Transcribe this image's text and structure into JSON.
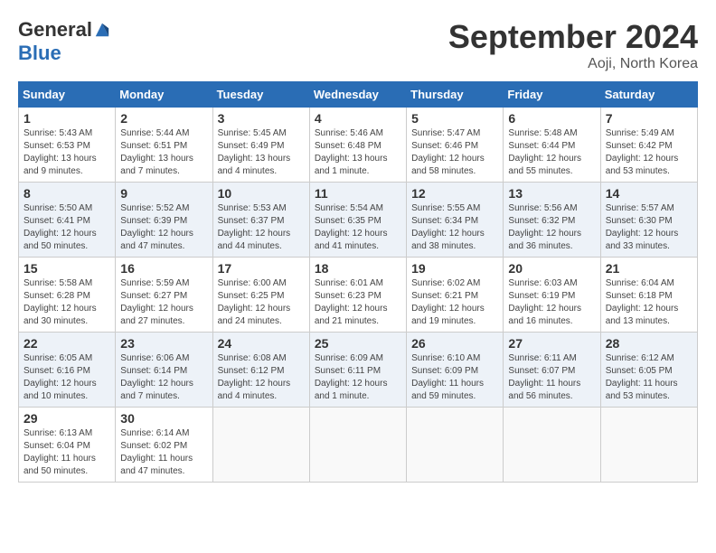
{
  "header": {
    "logo_general": "General",
    "logo_blue": "Blue",
    "month_title": "September 2024",
    "location": "Aoji, North Korea"
  },
  "days_of_week": [
    "Sunday",
    "Monday",
    "Tuesday",
    "Wednesday",
    "Thursday",
    "Friday",
    "Saturday"
  ],
  "weeks": [
    [
      {
        "day": "1",
        "info": "Sunrise: 5:43 AM\nSunset: 6:53 PM\nDaylight: 13 hours and 9 minutes."
      },
      {
        "day": "2",
        "info": "Sunrise: 5:44 AM\nSunset: 6:51 PM\nDaylight: 13 hours and 7 minutes."
      },
      {
        "day": "3",
        "info": "Sunrise: 5:45 AM\nSunset: 6:49 PM\nDaylight: 13 hours and 4 minutes."
      },
      {
        "day": "4",
        "info": "Sunrise: 5:46 AM\nSunset: 6:48 PM\nDaylight: 13 hours and 1 minute."
      },
      {
        "day": "5",
        "info": "Sunrise: 5:47 AM\nSunset: 6:46 PM\nDaylight: 12 hours and 58 minutes."
      },
      {
        "day": "6",
        "info": "Sunrise: 5:48 AM\nSunset: 6:44 PM\nDaylight: 12 hours and 55 minutes."
      },
      {
        "day": "7",
        "info": "Sunrise: 5:49 AM\nSunset: 6:42 PM\nDaylight: 12 hours and 53 minutes."
      }
    ],
    [
      {
        "day": "8",
        "info": "Sunrise: 5:50 AM\nSunset: 6:41 PM\nDaylight: 12 hours and 50 minutes."
      },
      {
        "day": "9",
        "info": "Sunrise: 5:52 AM\nSunset: 6:39 PM\nDaylight: 12 hours and 47 minutes."
      },
      {
        "day": "10",
        "info": "Sunrise: 5:53 AM\nSunset: 6:37 PM\nDaylight: 12 hours and 44 minutes."
      },
      {
        "day": "11",
        "info": "Sunrise: 5:54 AM\nSunset: 6:35 PM\nDaylight: 12 hours and 41 minutes."
      },
      {
        "day": "12",
        "info": "Sunrise: 5:55 AM\nSunset: 6:34 PM\nDaylight: 12 hours and 38 minutes."
      },
      {
        "day": "13",
        "info": "Sunrise: 5:56 AM\nSunset: 6:32 PM\nDaylight: 12 hours and 36 minutes."
      },
      {
        "day": "14",
        "info": "Sunrise: 5:57 AM\nSunset: 6:30 PM\nDaylight: 12 hours and 33 minutes."
      }
    ],
    [
      {
        "day": "15",
        "info": "Sunrise: 5:58 AM\nSunset: 6:28 PM\nDaylight: 12 hours and 30 minutes."
      },
      {
        "day": "16",
        "info": "Sunrise: 5:59 AM\nSunset: 6:27 PM\nDaylight: 12 hours and 27 minutes."
      },
      {
        "day": "17",
        "info": "Sunrise: 6:00 AM\nSunset: 6:25 PM\nDaylight: 12 hours and 24 minutes."
      },
      {
        "day": "18",
        "info": "Sunrise: 6:01 AM\nSunset: 6:23 PM\nDaylight: 12 hours and 21 minutes."
      },
      {
        "day": "19",
        "info": "Sunrise: 6:02 AM\nSunset: 6:21 PM\nDaylight: 12 hours and 19 minutes."
      },
      {
        "day": "20",
        "info": "Sunrise: 6:03 AM\nSunset: 6:19 PM\nDaylight: 12 hours and 16 minutes."
      },
      {
        "day": "21",
        "info": "Sunrise: 6:04 AM\nSunset: 6:18 PM\nDaylight: 12 hours and 13 minutes."
      }
    ],
    [
      {
        "day": "22",
        "info": "Sunrise: 6:05 AM\nSunset: 6:16 PM\nDaylight: 12 hours and 10 minutes."
      },
      {
        "day": "23",
        "info": "Sunrise: 6:06 AM\nSunset: 6:14 PM\nDaylight: 12 hours and 7 minutes."
      },
      {
        "day": "24",
        "info": "Sunrise: 6:08 AM\nSunset: 6:12 PM\nDaylight: 12 hours and 4 minutes."
      },
      {
        "day": "25",
        "info": "Sunrise: 6:09 AM\nSunset: 6:11 PM\nDaylight: 12 hours and 1 minute."
      },
      {
        "day": "26",
        "info": "Sunrise: 6:10 AM\nSunset: 6:09 PM\nDaylight: 11 hours and 59 minutes."
      },
      {
        "day": "27",
        "info": "Sunrise: 6:11 AM\nSunset: 6:07 PM\nDaylight: 11 hours and 56 minutes."
      },
      {
        "day": "28",
        "info": "Sunrise: 6:12 AM\nSunset: 6:05 PM\nDaylight: 11 hours and 53 minutes."
      }
    ],
    [
      {
        "day": "29",
        "info": "Sunrise: 6:13 AM\nSunset: 6:04 PM\nDaylight: 11 hours and 50 minutes."
      },
      {
        "day": "30",
        "info": "Sunrise: 6:14 AM\nSunset: 6:02 PM\nDaylight: 11 hours and 47 minutes."
      },
      {
        "day": "",
        "info": ""
      },
      {
        "day": "",
        "info": ""
      },
      {
        "day": "",
        "info": ""
      },
      {
        "day": "",
        "info": ""
      },
      {
        "day": "",
        "info": ""
      }
    ]
  ]
}
